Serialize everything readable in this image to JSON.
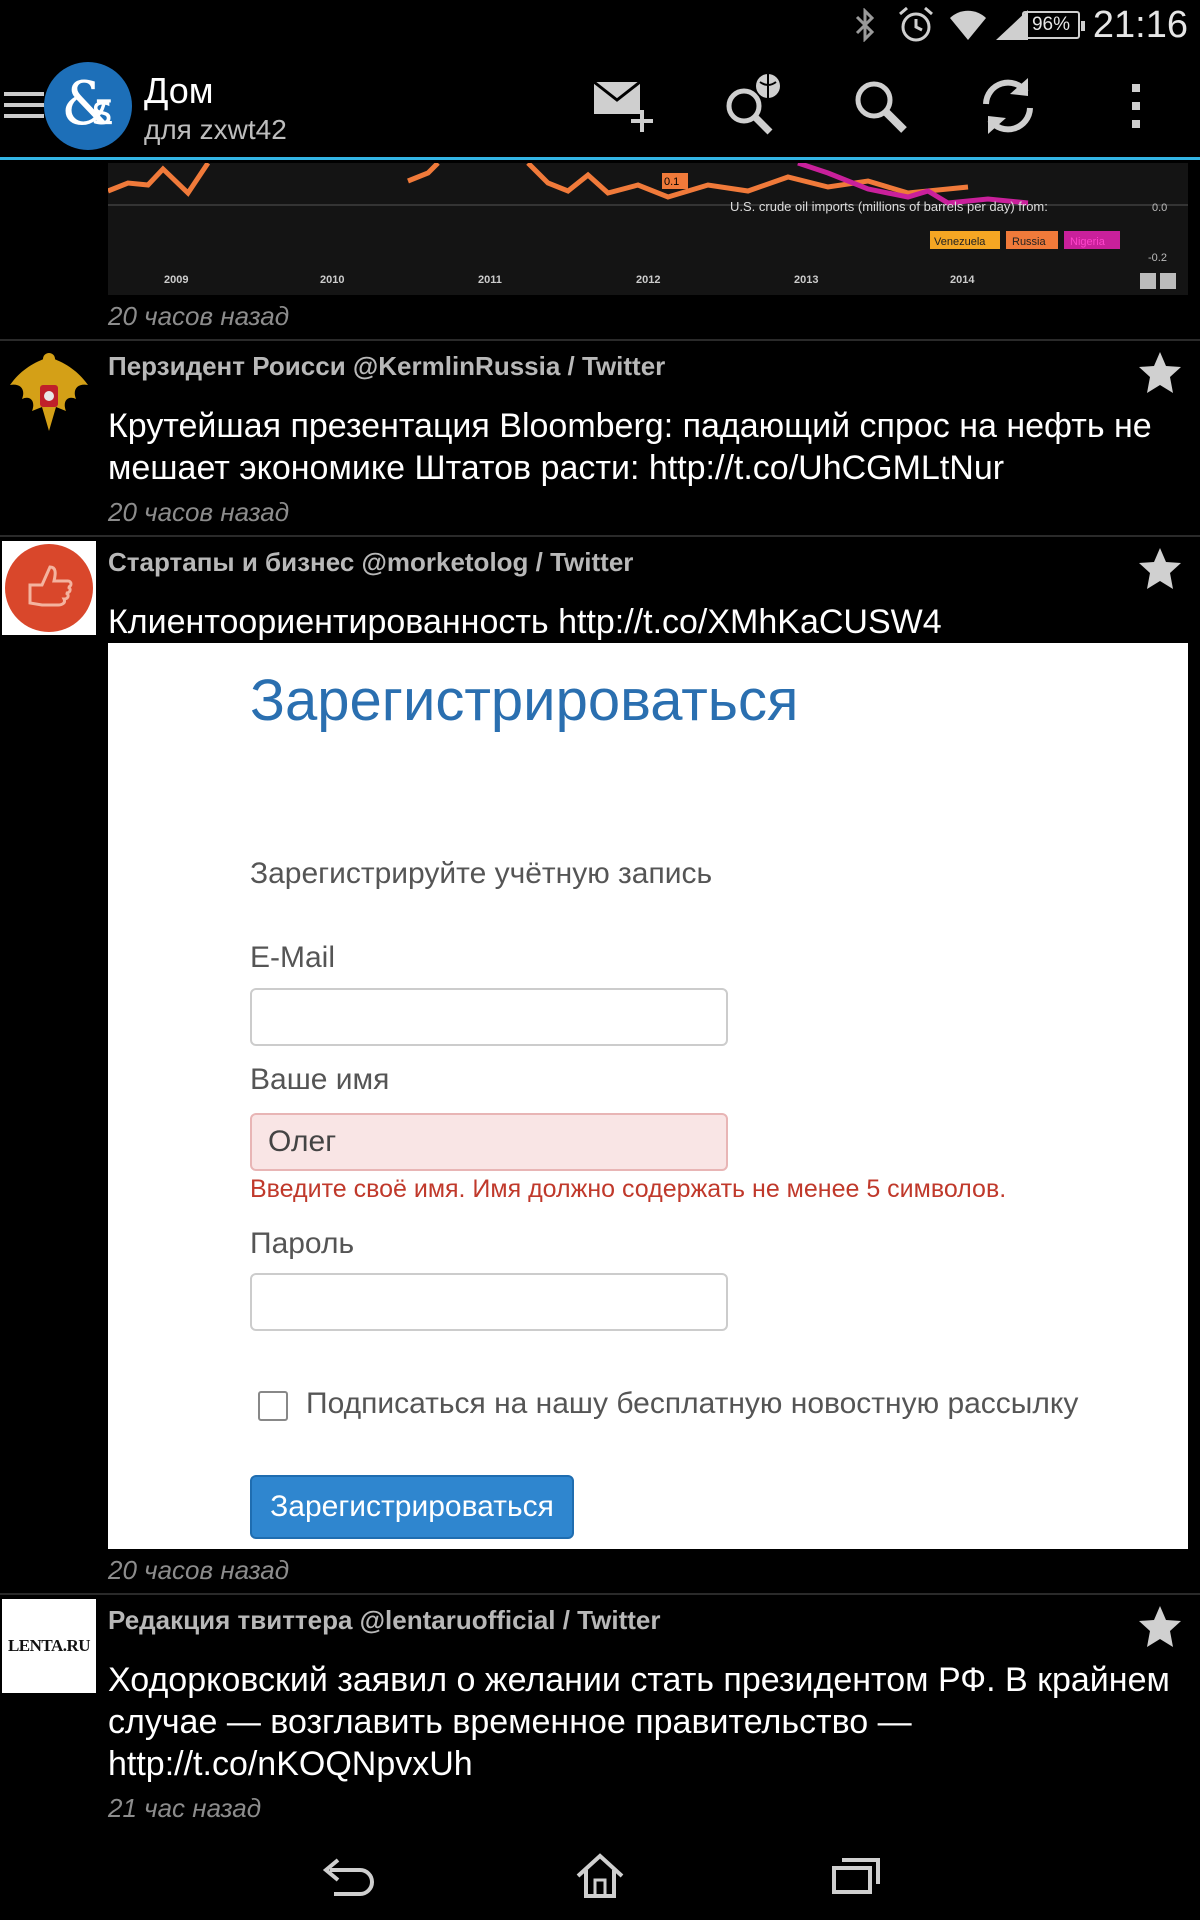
{
  "status_bar": {
    "time": "21:16",
    "battery": "96%"
  },
  "action_bar": {
    "title": "Дом",
    "subtitle": "для zxwt42"
  },
  "chart_thumbnail": {
    "years": [
      "2009",
      "2010",
      "2011",
      "2012",
      "2013",
      "2014"
    ],
    "caption": "U.S. crude oil imports (millions of barrels per day) from:",
    "legend": [
      "Venezuela",
      "Russia",
      "Nigeria"
    ],
    "tick_right": [
      "0.0",
      "-0.2"
    ],
    "annotation": "0.1"
  },
  "feed": [
    {
      "timestamp": "20 часов назад"
    },
    {
      "author": "Перзидент Роисси @KermlinRussia / Twitter",
      "text": "Крутейшая презентация Bloomberg: падающий спрос на нефть не мешает экономике Штатов расти: http://t.co/UhCGMLtNur",
      "timestamp": "20 часов назад"
    },
    {
      "author": "Стартапы и бизнес @morketolog / Twitter",
      "text": "Клиентоориентированность http://t.co/XMhKaCUSW4",
      "timestamp": "20 часов назад",
      "image_form": {
        "title": "Зарегистрироваться",
        "subtitle": "Зарегистрируйте учётную запись",
        "email_label": "E-Mail",
        "email_value": "",
        "name_label": "Ваше имя",
        "name_value": "Олег",
        "error": "Введите своё имя. Имя должно содержать не менее 5 символов.",
        "password_label": "Пароль",
        "password_value": "",
        "newsletter_label": "Подписаться на нашу бесплатную новостную рассылку",
        "submit_label": "Зарегистрироваться"
      }
    },
    {
      "author": "Редакция твиттера @lentaruofficial / Twitter",
      "avatar_text": "LENTA.RU",
      "text": "Ходорковский заявил о желании стать президентом РФ. В крайнем случае — возглавить временное правительство — http://t.co/nKOQNpvxUh",
      "timestamp": "21 час назад"
    }
  ],
  "colors": {
    "accent": "#33b5e5",
    "logo": "#1d6fb8",
    "chart_orange": "#f07a3a",
    "chart_magenta": "#c9209b"
  }
}
